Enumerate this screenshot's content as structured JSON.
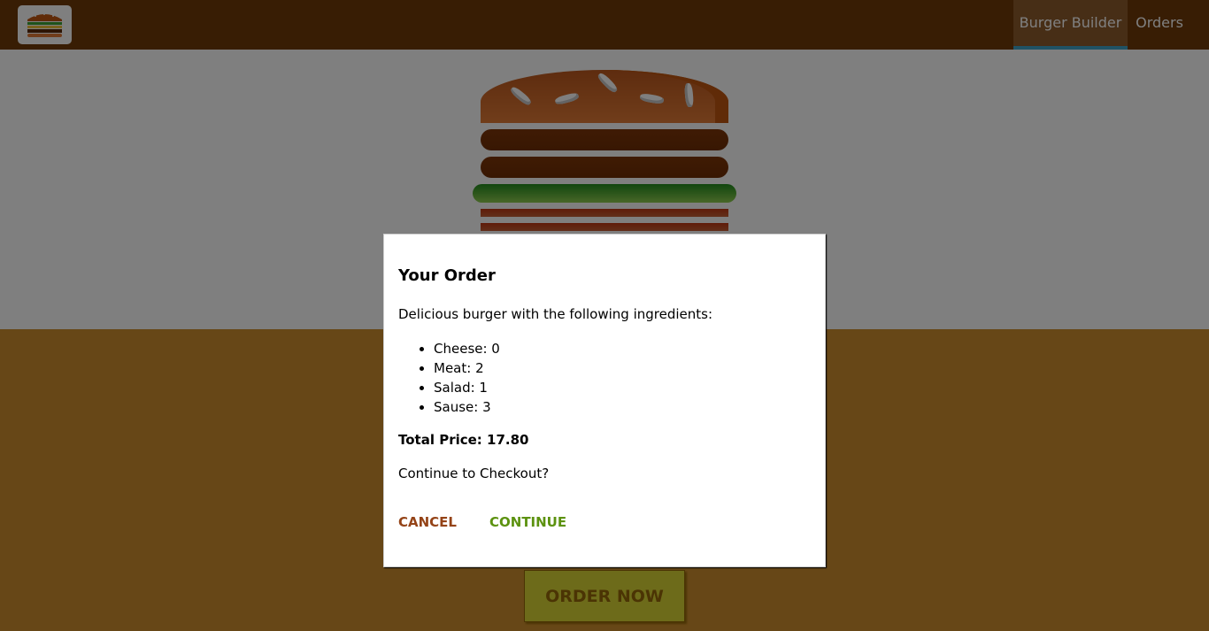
{
  "toolbar": {
    "logo_alt": "burger-logo",
    "nav": [
      {
        "label": "Burger Builder",
        "active": true
      },
      {
        "label": "Orders",
        "active": false
      }
    ]
  },
  "burger": {
    "ingredients": [
      "bread-top",
      "meat",
      "meat",
      "salad",
      "bacon",
      "bacon"
    ]
  },
  "controls": {
    "order_button_label": "ORDER NOW"
  },
  "modal": {
    "title": "Your Order",
    "description": "Delicious burger with the following ingredients:",
    "ingredients": [
      {
        "name": "Cheese",
        "count": 0,
        "text": "Cheese: 0"
      },
      {
        "name": "Meat",
        "count": 2,
        "text": "Meat: 2"
      },
      {
        "name": "Salad",
        "count": 1,
        "text": "Salad: 1"
      },
      {
        "name": "Sause",
        "count": 3,
        "text": "Sause: 3"
      }
    ],
    "total_price_text": "Total Price: 17.80",
    "question": "Continue to Checkout?",
    "cancel_label": "CANCEL",
    "continue_label": "CONTINUE"
  },
  "colors": {
    "toolbar": "#703B09",
    "active_nav": "#8F5C2C",
    "active_nav_border": "#40A4C8",
    "controls_bg": "#CF8F2E",
    "order_button_bg": "#DAD735",
    "order_button_text": "#966909",
    "cancel": "#944317",
    "continue": "#5C9210"
  }
}
